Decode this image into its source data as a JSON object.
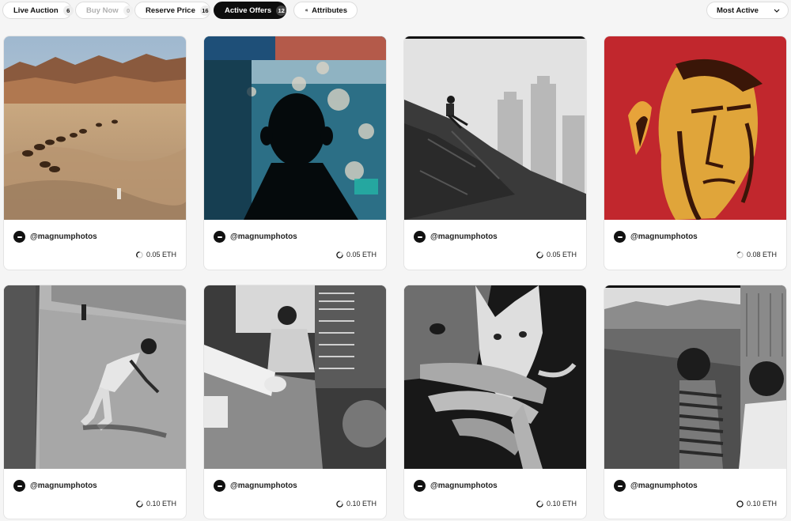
{
  "filters": [
    {
      "label": "Live Auction",
      "count": "6",
      "state": "normal"
    },
    {
      "label": "Buy Now",
      "count": "0",
      "state": "disabled"
    },
    {
      "label": "Reserve Price",
      "count": "16",
      "state": "normal"
    },
    {
      "label": "Active Offers",
      "count": "12",
      "state": "active"
    }
  ],
  "attributes_label": "Attributes",
  "sort": {
    "selected": "Most Active"
  },
  "cards": [
    {
      "handle": "@magnumphotos",
      "price": "0.05 ETH",
      "image_icon": "desert-camel-caravan-photo"
    },
    {
      "handle": "@magnumphotos",
      "price": "0.05 ETH",
      "image_icon": "shadow-on-blue-wall-photo"
    },
    {
      "handle": "@magnumphotos",
      "price": "0.05 ETH",
      "image_icon": "boy-on-rock-skyline-photo"
    },
    {
      "handle": "@magnumphotos",
      "price": "0.08 ETH",
      "image_icon": "red-pop-art-portrait"
    },
    {
      "handle": "@magnumphotos",
      "price": "0.10 ETH",
      "image_icon": "boy-playing-street-photo"
    },
    {
      "handle": "@magnumphotos",
      "price": "0.10 ETH",
      "image_icon": "man-at-desk-studio-photo"
    },
    {
      "handle": "@magnumphotos",
      "price": "0.10 ETH",
      "image_icon": "kitten-in-hand-photo"
    },
    {
      "handle": "@magnumphotos",
      "price": "0.10 ETH",
      "image_icon": "children-train-window-photo"
    }
  ],
  "colors": {
    "active_pill": "#0d0d0d",
    "background": "#f5f5f5",
    "card": "#ffffff",
    "warhol_red": "#c1272d"
  }
}
